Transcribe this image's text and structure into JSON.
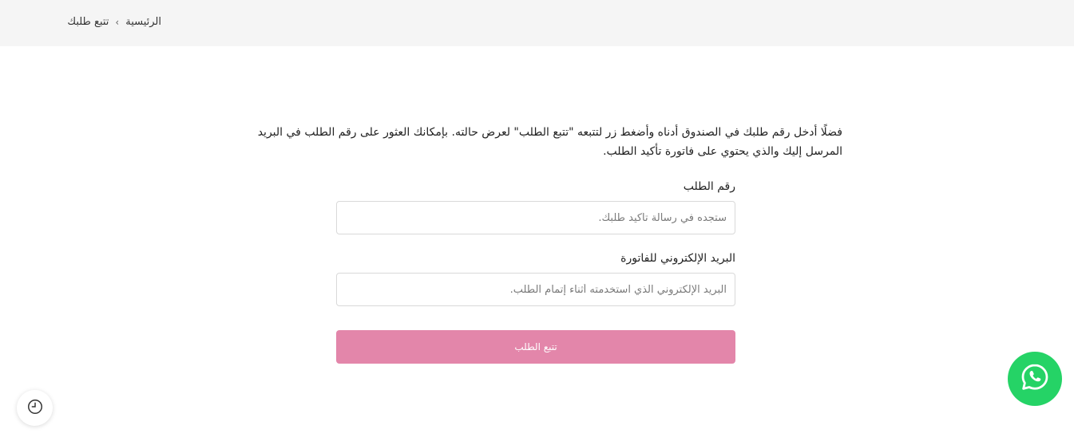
{
  "breadcrumb": {
    "home_label": "الرئيسية",
    "separator": "›",
    "current_label": "تتبع طلبك"
  },
  "intro": {
    "text": "فضلًا أدخل رقم طلبك في الصندوق أدناه وأضغط زر لتتبعه \"تتبع الطلب\" لعرض حالته. بإمكانك العثور على رقم الطلب في البريد المرسل إليك والذي يحتوي على فاتورة تأكيد الطلب."
  },
  "form": {
    "order_number": {
      "label": "رقم الطلب",
      "placeholder": "ستجده في رسالة تأكيد طلبك.",
      "value": ""
    },
    "billing_email": {
      "label": "البريد الإلكتروني للفاتورة",
      "placeholder": "البريد الإلكتروني الذي استخدمته أثناء إتمام الطلب.",
      "value": ""
    },
    "submit_label": "تتبع الطلب"
  },
  "floating": {
    "history_icon": "clock-history-icon",
    "whatsapp_icon": "whatsapp-icon"
  },
  "colors": {
    "accent": "#e386aa",
    "whatsapp": "#25d366",
    "breadcrumb_bg": "#f5f5f5"
  }
}
